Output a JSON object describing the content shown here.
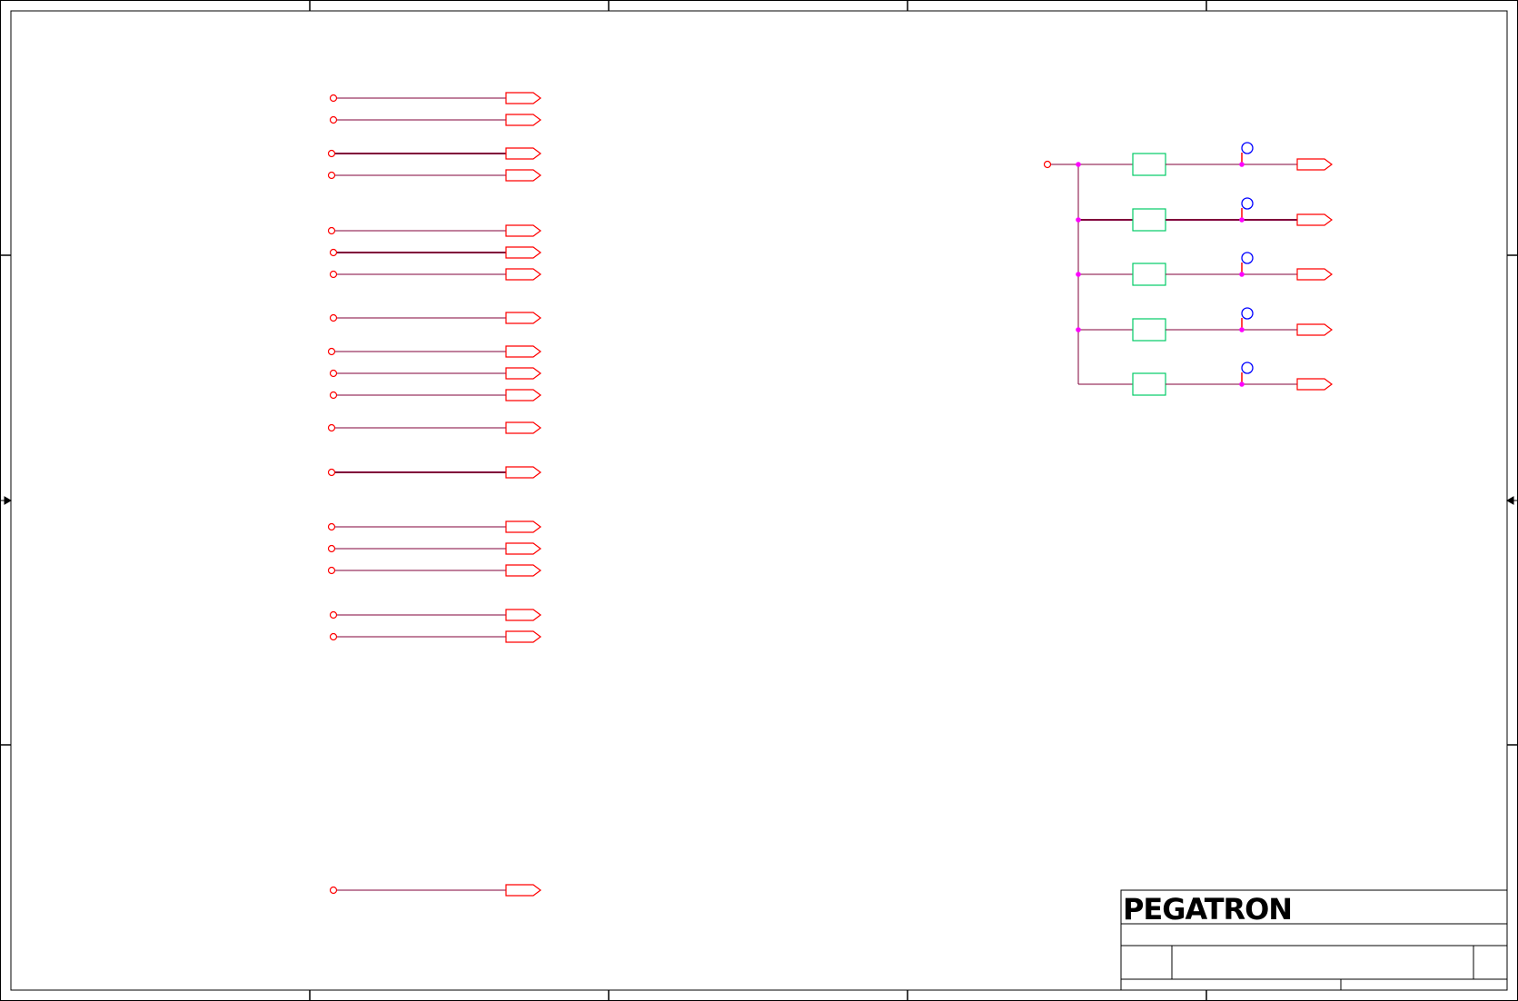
{
  "titleblock": {
    "logo": "PEGATRON"
  },
  "colors": {
    "border": "#000000",
    "wire": "#80003a",
    "port": "#ff0000",
    "resistor": "#00cc66",
    "junction": "#ff00ff",
    "test_point": "#0000ff",
    "background": "#ffffff"
  },
  "left_nets": {
    "count": 19,
    "thick_rows": [
      2,
      5,
      12
    ]
  },
  "right_block": {
    "branches": 5,
    "components_per_branch": [
      "resistor",
      "test-point-circle",
      "offpage-port"
    ]
  }
}
